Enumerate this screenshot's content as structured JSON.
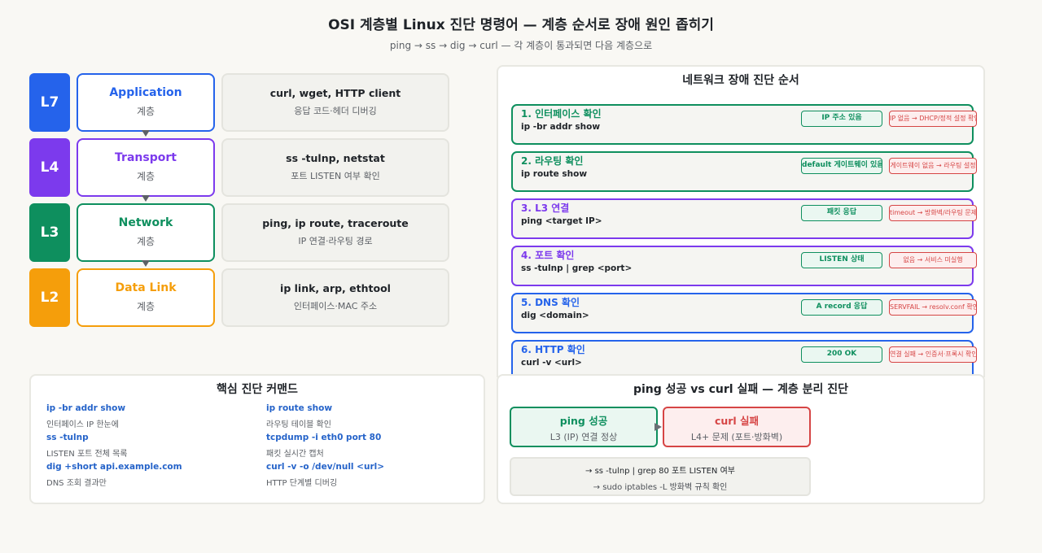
{
  "title": "OSI 계층별 Linux 진단 명령어 — 계층 순서로 장애 원인 좁히기",
  "subtitle": "ping → ss → dig → curl — 각 계층이 통과되면 다음 계층으로",
  "layers": [
    {
      "badge": "L7",
      "name": "Application",
      "sub": "계층",
      "cmd": "curl, wget, HTTP client",
      "desc": "응답 코드·헤더 디버깅",
      "color": "#2563eb"
    },
    {
      "badge": "L4",
      "name": "Transport",
      "sub": "계층",
      "cmd": "ss -tulnp, netstat",
      "desc": "포트 LISTEN 여부 확인",
      "color": "#7c3aed"
    },
    {
      "badge": "L3",
      "name": "Network",
      "sub": "계층",
      "cmd": "ping, ip route, traceroute",
      "desc": "IP 연결·라우팅 경로",
      "color": "#0e8f5e"
    },
    {
      "badge": "L2",
      "name": "Data Link",
      "sub": "계층",
      "cmd": "ip link, arp, ethtool",
      "desc": "인터페이스·MAC 주소",
      "color": "#f59e0b"
    }
  ],
  "diag": {
    "title": "네트워크 장애 진단 순서",
    "steps": [
      {
        "title": "1. 인터페이스 확인",
        "cmd": "ip -br addr show",
        "ok": "IP 주소 있음",
        "fail": "IP 없음 → DHCP/정적 설정 확인",
        "color": "#0e8f5e"
      },
      {
        "title": "2. 라우팅 확인",
        "cmd": "ip route show",
        "ok": "default 게이트웨이 있음",
        "fail": "게이트웨이 없음 → 라우팅 설정",
        "color": "#0e8f5e"
      },
      {
        "title": "3. L3 연결",
        "cmd": "ping <target IP>",
        "ok": "패킷 응답",
        "fail": "timeout → 방화벽/라우팅 문제",
        "color": "#7c3aed"
      },
      {
        "title": "4. 포트 확인",
        "cmd": "ss -tulnp | grep <port>",
        "ok": "LISTEN 상태",
        "fail": "없음 → 서비스 미실행",
        "color": "#7c3aed"
      },
      {
        "title": "5. DNS 확인",
        "cmd": "dig <domain>",
        "ok": "A record 응답",
        "fail": "SERVFAIL → resolv.conf 확인",
        "color": "#2563eb"
      },
      {
        "title": "6. HTTP 확인",
        "cmd": "curl -v <url>",
        "ok": "200 OK",
        "fail": "연결 실패 → 인증서·프록시 확인",
        "color": "#2563eb"
      }
    ]
  },
  "key": {
    "title": "핵심 진단 커맨드",
    "items": [
      {
        "cmd": "ip -br addr show",
        "desc": "인터페이스 IP 한눈에"
      },
      {
        "cmd": "ip route show",
        "desc": "라우팅 테이블 확인"
      },
      {
        "cmd": "ss -tulnp",
        "desc": "LISTEN 포트 전체 목록"
      },
      {
        "cmd": "tcpdump -i eth0 port 80",
        "desc": "패킷 실시간 캡처"
      },
      {
        "cmd": "dig +short api.example.com",
        "desc": "DNS 조회 결과만"
      },
      {
        "cmd": "curl -v -o /dev/null <url>",
        "desc": "HTTP 단계별 디버깅"
      }
    ]
  },
  "split": {
    "title": "ping 성공 vs curl 실패 — 계층 분리 진단",
    "ok_title": "ping 성공",
    "ok_sub": "L3 (IP) 연결 정상",
    "fail_title": "curl 실패",
    "fail_sub": "L4+ 문제 (포트·방화벽)",
    "tip1": "→ ss -tulnp | grep 80 포트 LISTEN 여부",
    "tip2": "→ sudo iptables -L 방화벽 규칙 확인"
  }
}
